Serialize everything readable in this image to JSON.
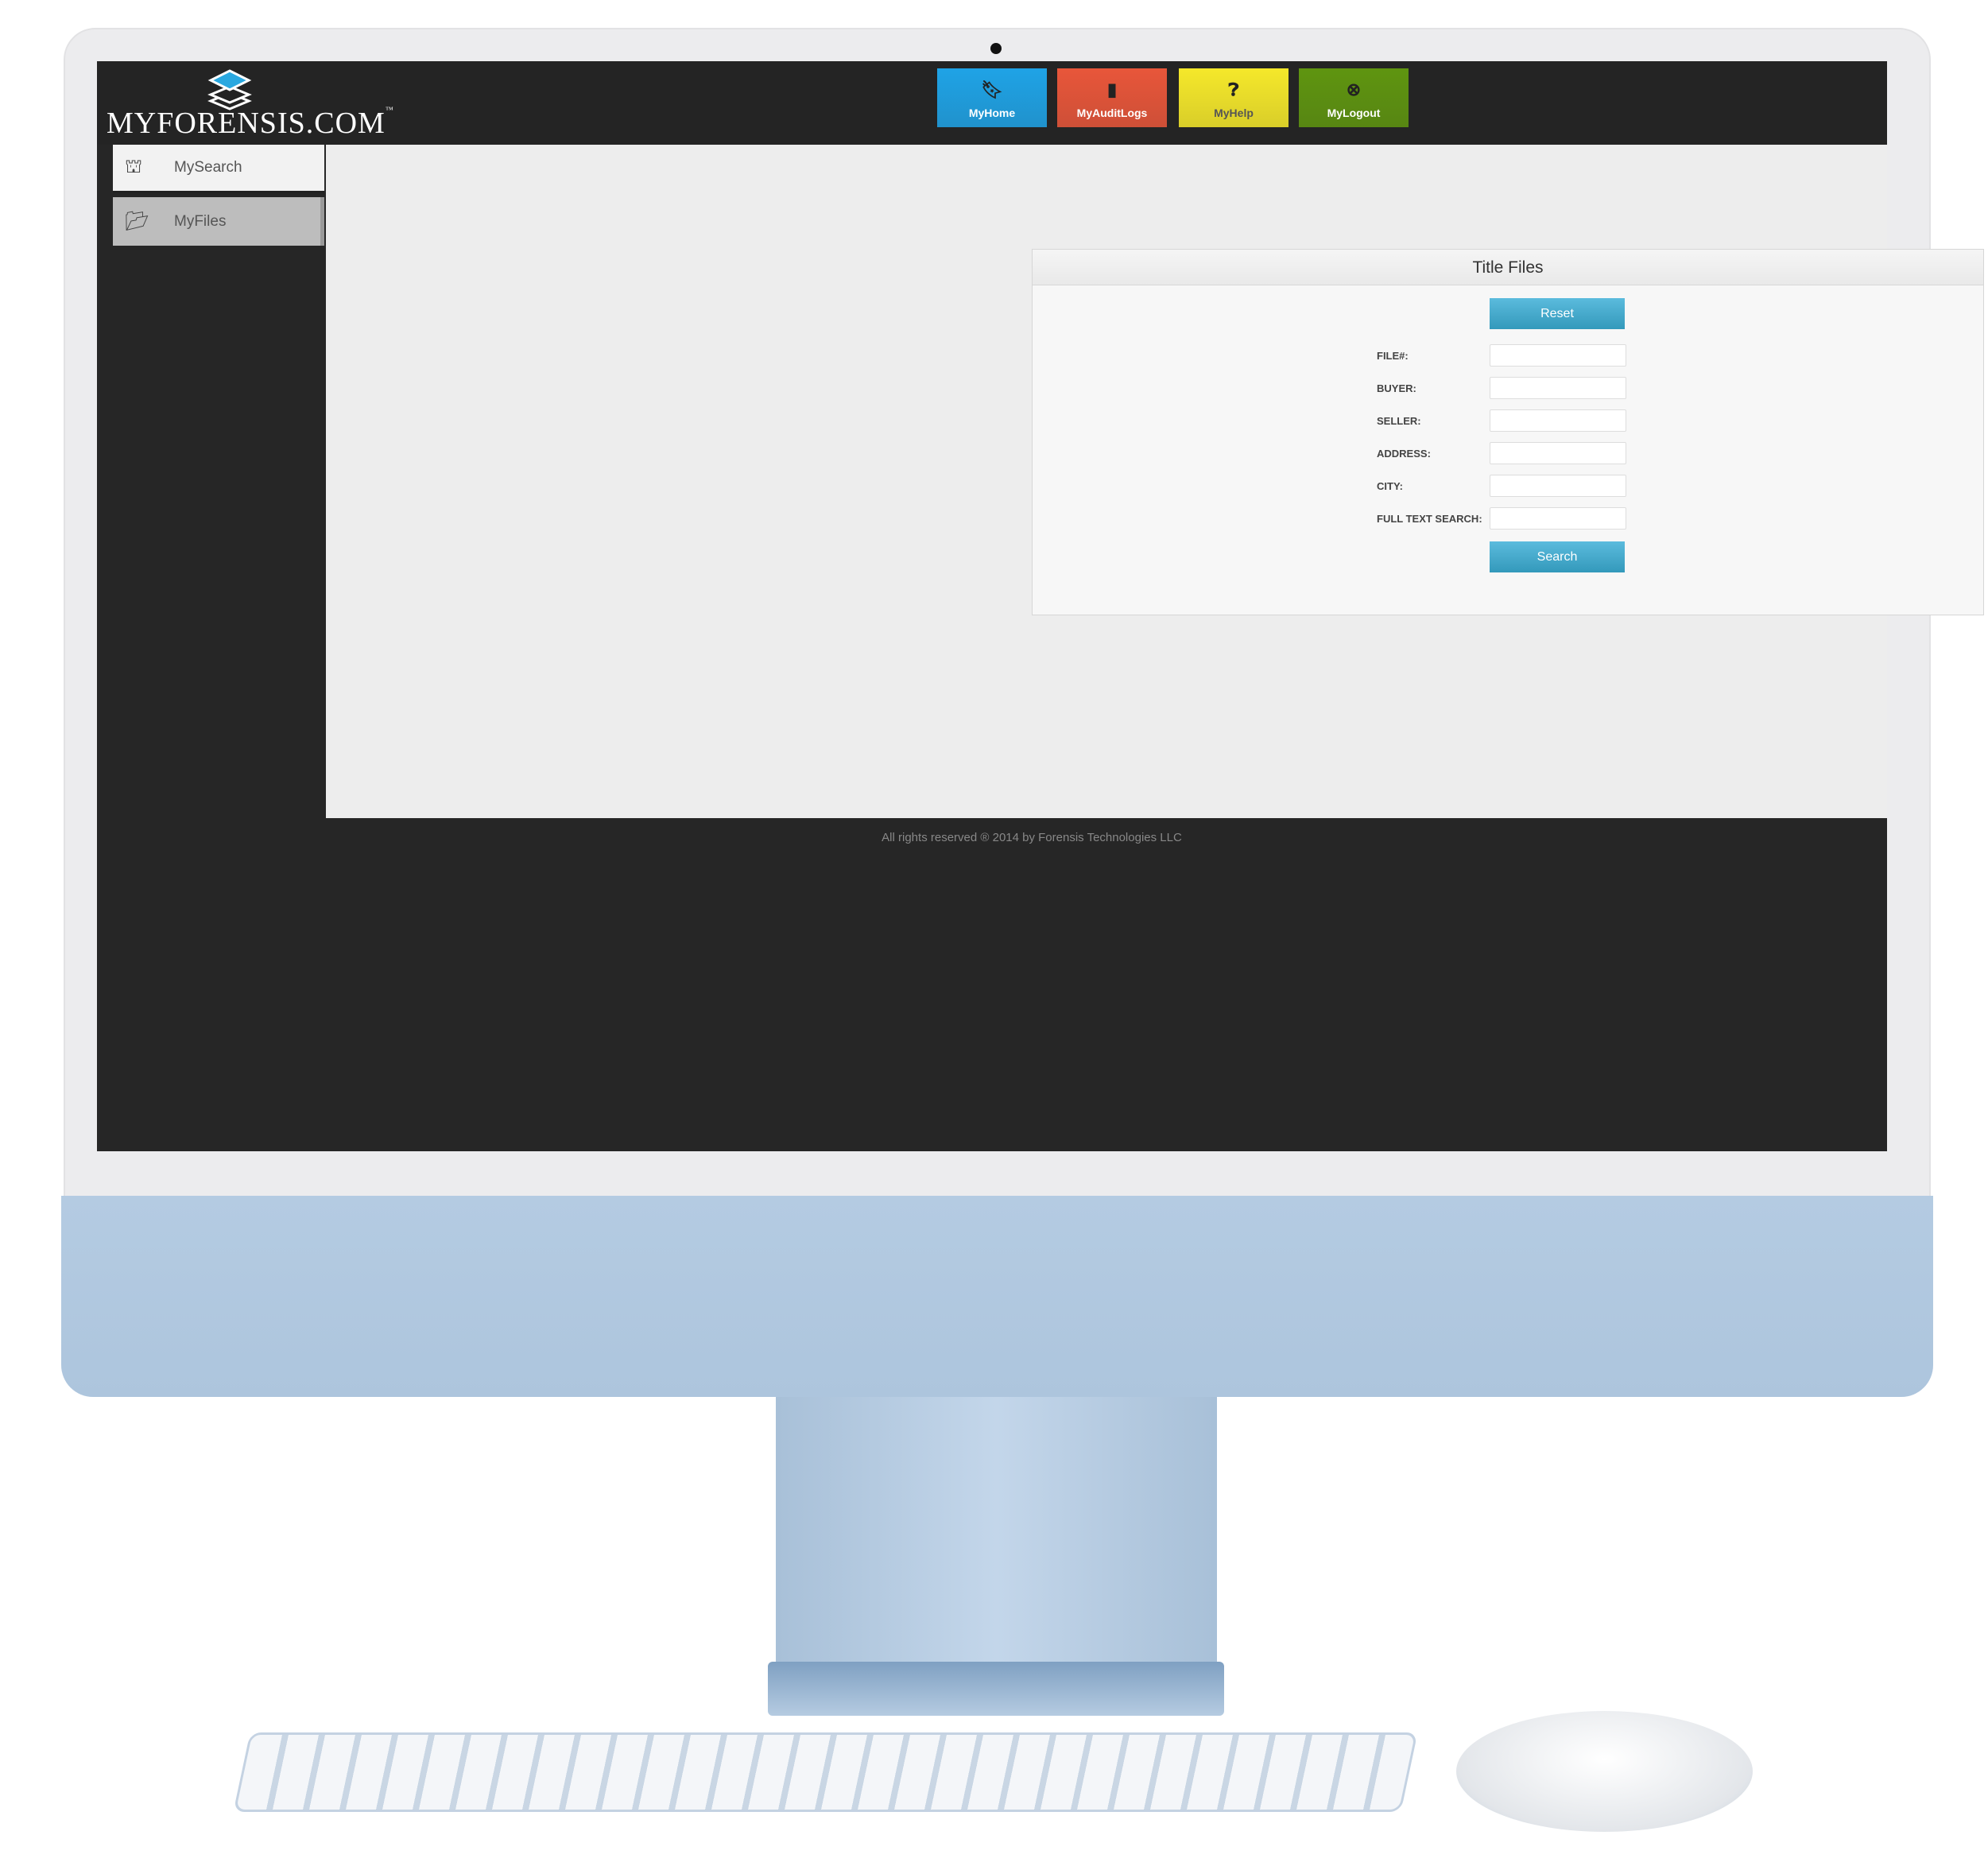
{
  "app": {
    "logo_text": "MYFORENSIS.COM",
    "logo_tm": "™"
  },
  "nav": [
    {
      "label": "MyHome",
      "icon": "bookmark-icon",
      "color": "#1fa3e6"
    },
    {
      "label": "MyAuditLogs",
      "icon": "book-icon",
      "color": "#e8563a"
    },
    {
      "label": "MyHelp",
      "icon": "question-circle-icon",
      "color": "#f5e82a"
    },
    {
      "label": "MyLogout",
      "icon": "close-circle-icon",
      "color": "#5f9510"
    }
  ],
  "sidebar": {
    "items": [
      {
        "label": "MySearch",
        "icon": "binoculars-icon"
      },
      {
        "label": "MyFiles",
        "icon": "folder-open-icon"
      }
    ]
  },
  "panel": {
    "title": "Title Files",
    "reset_label": "Reset",
    "search_label": "Search",
    "fields": [
      {
        "label": "FILE#:",
        "value": ""
      },
      {
        "label": "BUYER:",
        "value": ""
      },
      {
        "label": "SELLER:",
        "value": ""
      },
      {
        "label": "ADDRESS:",
        "value": ""
      },
      {
        "label": "CITY:",
        "value": ""
      },
      {
        "label": "FULL TEXT SEARCH:",
        "value": ""
      }
    ]
  },
  "footer": {
    "text": "All rights reserved ® 2014 by Forensis Technologies LLC"
  }
}
